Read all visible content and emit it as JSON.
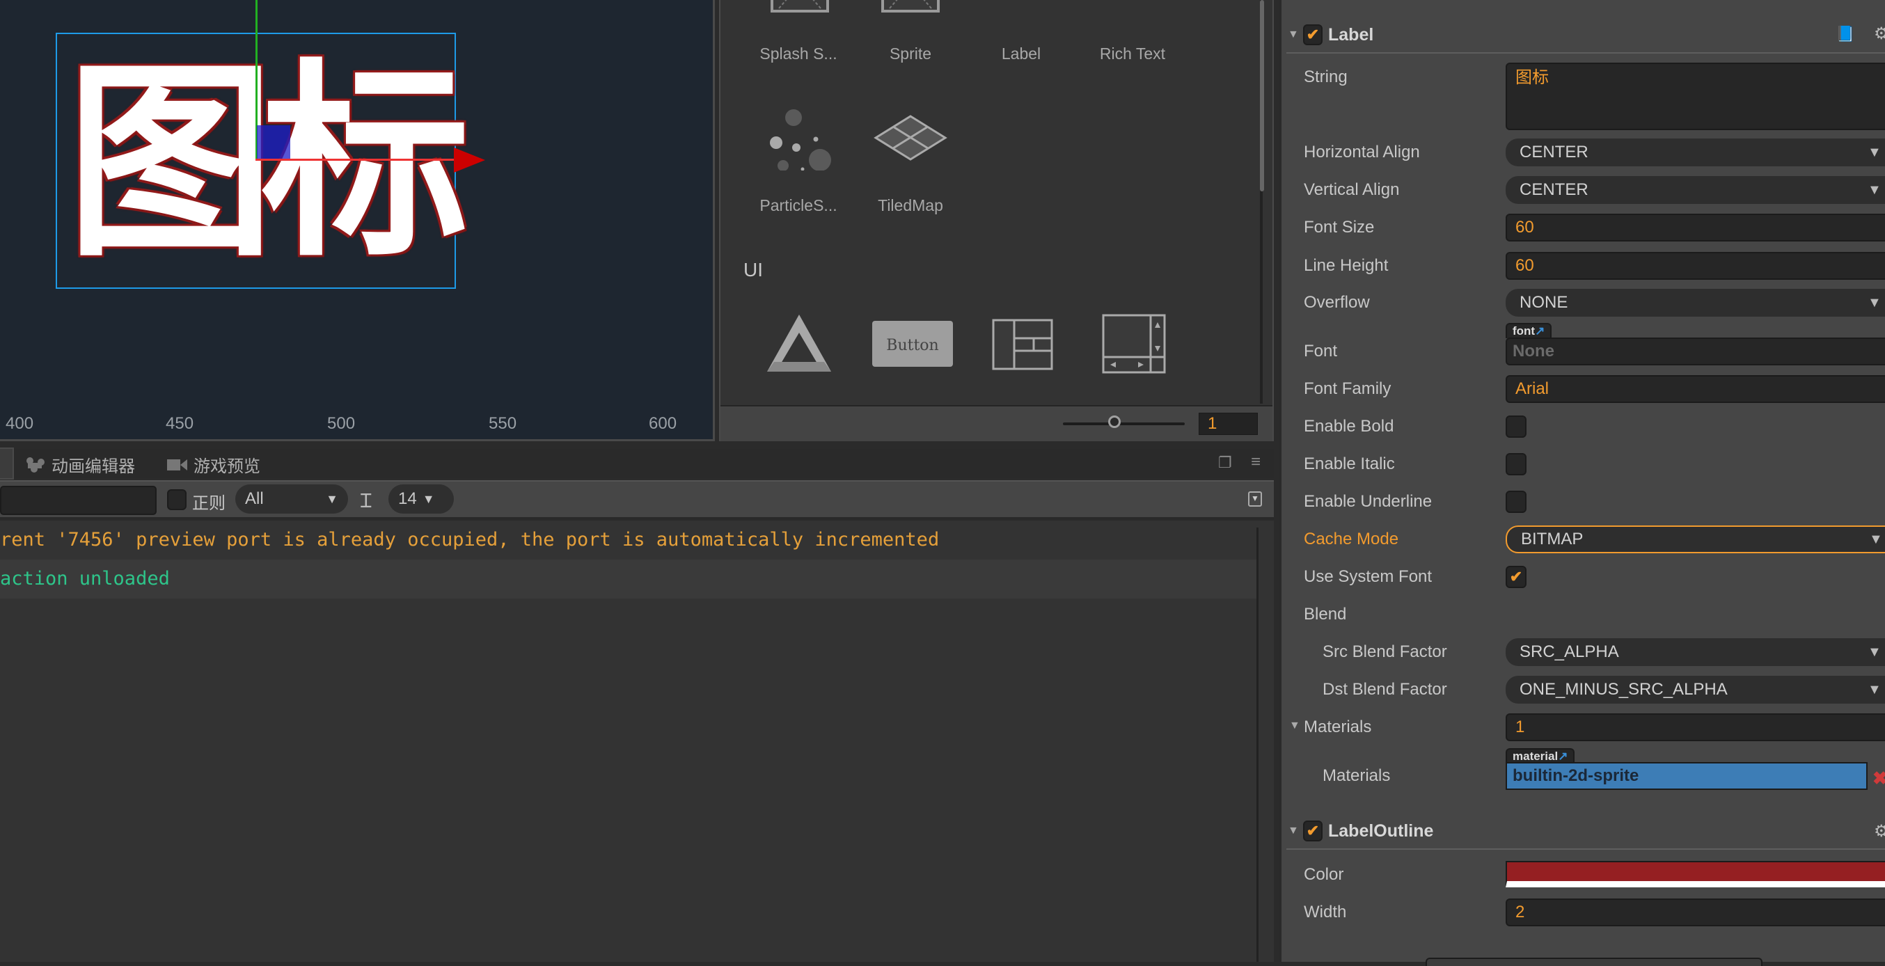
{
  "scene": {
    "label_text": "图标",
    "ruler_ticks": [
      "400",
      "450",
      "500",
      "550",
      "600"
    ]
  },
  "node_library": {
    "row1": [
      "Splash S...",
      "Sprite",
      "Label",
      "Rich Text"
    ],
    "row2": [
      "ParticleS...",
      "TiledMap"
    ],
    "ui_section_title": "UI",
    "ui_icons": [
      "canvas-icon",
      "button-icon",
      "layout-icon",
      "scrollview-icon"
    ],
    "button_icon_text": "Button",
    "zoom_value": "1"
  },
  "console": {
    "tabs": [
      {
        "label": "动画编辑器",
        "icon": "animation-editor-icon"
      },
      {
        "label": "游戏预览",
        "icon": "game-preview-icon"
      }
    ],
    "filter_value": "",
    "regex_label": "正则",
    "regex_checked": false,
    "level_select": "All",
    "font_size_select": "14",
    "logs": [
      {
        "text": "rent '7456' preview port is already occupied, the port is automatically incremented",
        "level": "warning",
        "color": "#e5a03a"
      },
      {
        "text": "action unloaded",
        "level": "success",
        "color": "#2ec58a"
      }
    ]
  },
  "inspector": {
    "label_component": {
      "title": "Label",
      "enabled": true,
      "properties": {
        "string": {
          "label": "String",
          "value": "图标"
        },
        "horizontal_align": {
          "label": "Horizontal Align",
          "value": "CENTER"
        },
        "vertical_align": {
          "label": "Vertical Align",
          "value": "CENTER"
        },
        "font_size": {
          "label": "Font Size",
          "value": "60"
        },
        "line_height": {
          "label": "Line Height",
          "value": "60"
        },
        "overflow": {
          "label": "Overflow",
          "value": "NONE"
        },
        "font": {
          "label": "Font",
          "tag": "font",
          "value": "None"
        },
        "font_family": {
          "label": "Font Family",
          "value": "Arial"
        },
        "enable_bold": {
          "label": "Enable Bold",
          "checked": false
        },
        "enable_italic": {
          "label": "Enable Italic",
          "checked": false
        },
        "enable_underline": {
          "label": "Enable Underline",
          "checked": false
        },
        "cache_mode": {
          "label": "Cache Mode",
          "value": "BITMAP"
        },
        "use_system_font": {
          "label": "Use System Font",
          "checked": true
        },
        "blend": {
          "label": "Blend"
        },
        "src_blend_factor": {
          "label": "Src Blend Factor",
          "value": "SRC_ALPHA"
        },
        "dst_blend_factor": {
          "label": "Dst Blend Factor",
          "value": "ONE_MINUS_SRC_ALPHA"
        },
        "materials": {
          "label": "Materials",
          "value": "1"
        },
        "materials_item": {
          "label": "Materials",
          "tag": "material",
          "value": "builtin-2d-sprite"
        }
      }
    },
    "label_outline_component": {
      "title": "LabelOutline",
      "enabled": true,
      "properties": {
        "color": {
          "label": "Color",
          "value": "#951f22"
        },
        "width": {
          "label": "Width",
          "value": "2"
        }
      }
    },
    "colors": {
      "accent": "#f29b2e",
      "link": "#3a8fd8",
      "material_highlight": "#3d7db6"
    }
  }
}
